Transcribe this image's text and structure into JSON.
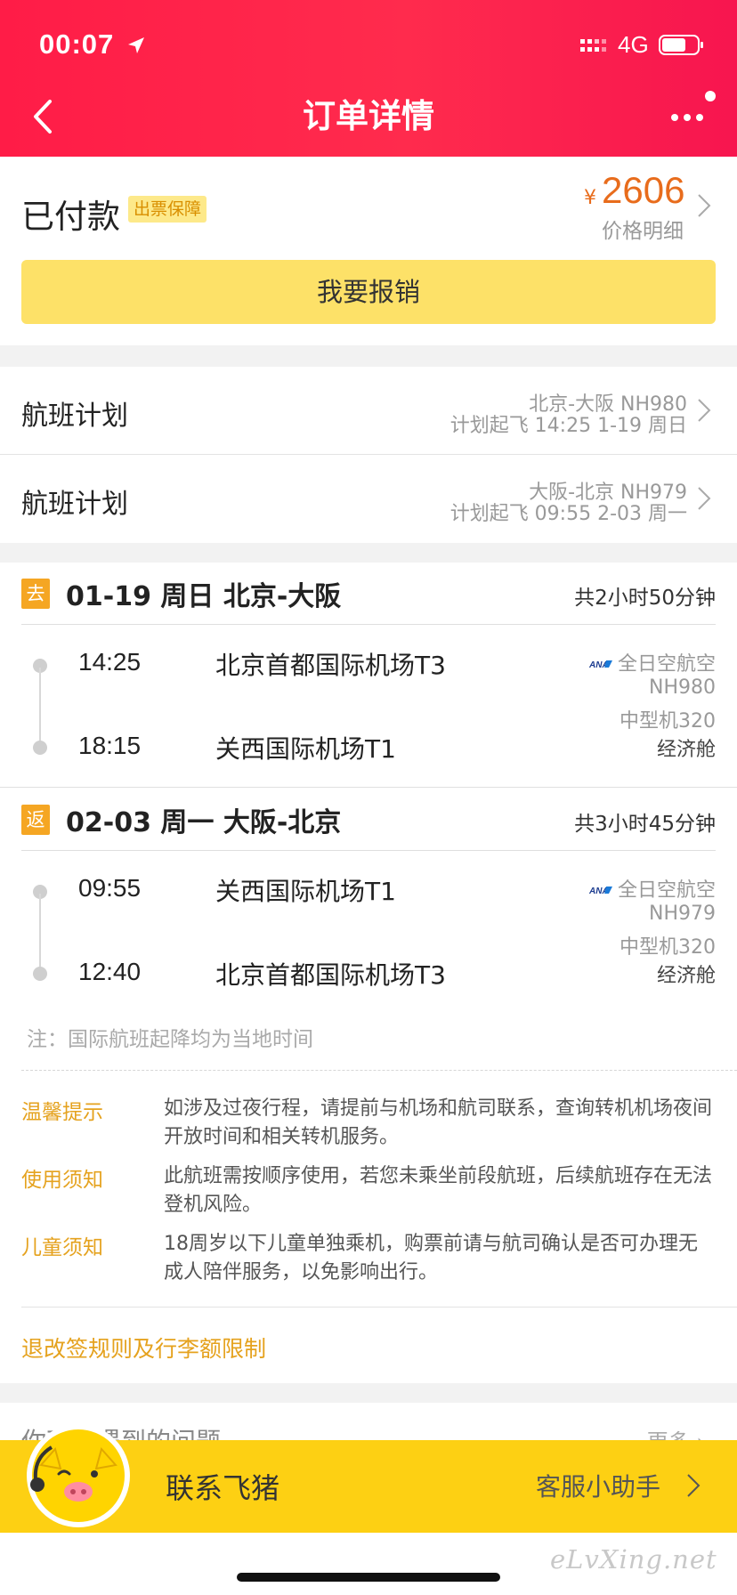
{
  "status_bar": {
    "time": "00:07",
    "network": "4G"
  },
  "header": {
    "title": "订单详情"
  },
  "payment": {
    "status": "已付款",
    "badge": "出票保障",
    "currency": "¥",
    "price": "2606",
    "price_detail_label": "价格明细",
    "reimburse_label": "我要报销"
  },
  "flight_plans": [
    {
      "title": "航班计划",
      "route": "北京-大阪 NH980",
      "schedule": "计划起飞 14:25 1-19 周日"
    },
    {
      "title": "航班计划",
      "route": "大阪-北京 NH979",
      "schedule": "计划起飞 09:55 2-03 周一"
    }
  ],
  "legs": [
    {
      "tag": "去",
      "title": "01-19 周日 北京-大阪",
      "duration": "共2小时50分钟",
      "depart_time": "14:25",
      "depart_airport": "北京首都国际机场T3",
      "arrive_time": "18:15",
      "arrive_airport": "关西国际机场T1",
      "airline": "全日空航空",
      "flight_no": "NH980",
      "aircraft": "中型机320",
      "cabin": "经济舱"
    },
    {
      "tag": "返",
      "title": "02-03 周一 大阪-北京",
      "duration": "共3小时45分钟",
      "depart_time": "09:55",
      "depart_airport": "关西国际机场T1",
      "arrive_time": "12:40",
      "arrive_airport": "北京首都国际机场T3",
      "airline": "全日空航空",
      "flight_no": "NH979",
      "aircraft": "中型机320",
      "cabin": "经济舱"
    }
  ],
  "timezone_note": "注：国际航班起降均为当地时间",
  "notices": [
    {
      "title": "温馨提示",
      "text": "如涉及过夜行程，请提前与机场和航司联系，查询转机机场夜间开放时间和相关转机服务。"
    },
    {
      "title": "使用须知",
      "text": "此航班需按顺序使用，若您未乘坐前段航班，后续航班存在无法登机风险。"
    },
    {
      "title": "儿童须知",
      "text": "18周岁以下儿童单独乘机，购票前请与航司确认是否可办理无成人陪伴服务，以免影响出行。"
    }
  ],
  "rules_link": "退改签规则及行李额限制",
  "problems": {
    "title": "你可能遇到的问题",
    "more": "更多 ›"
  },
  "contact": {
    "label": "联系飞猪",
    "assistant": "客服小助手"
  },
  "watermark": "eLvXing.net",
  "colors": {
    "header_red": "#ff1c47",
    "price_orange": "#e86c1c",
    "button_yellow": "#fde168",
    "contact_yellow": "#fdd013",
    "notice_orange": "#e5a21e"
  }
}
